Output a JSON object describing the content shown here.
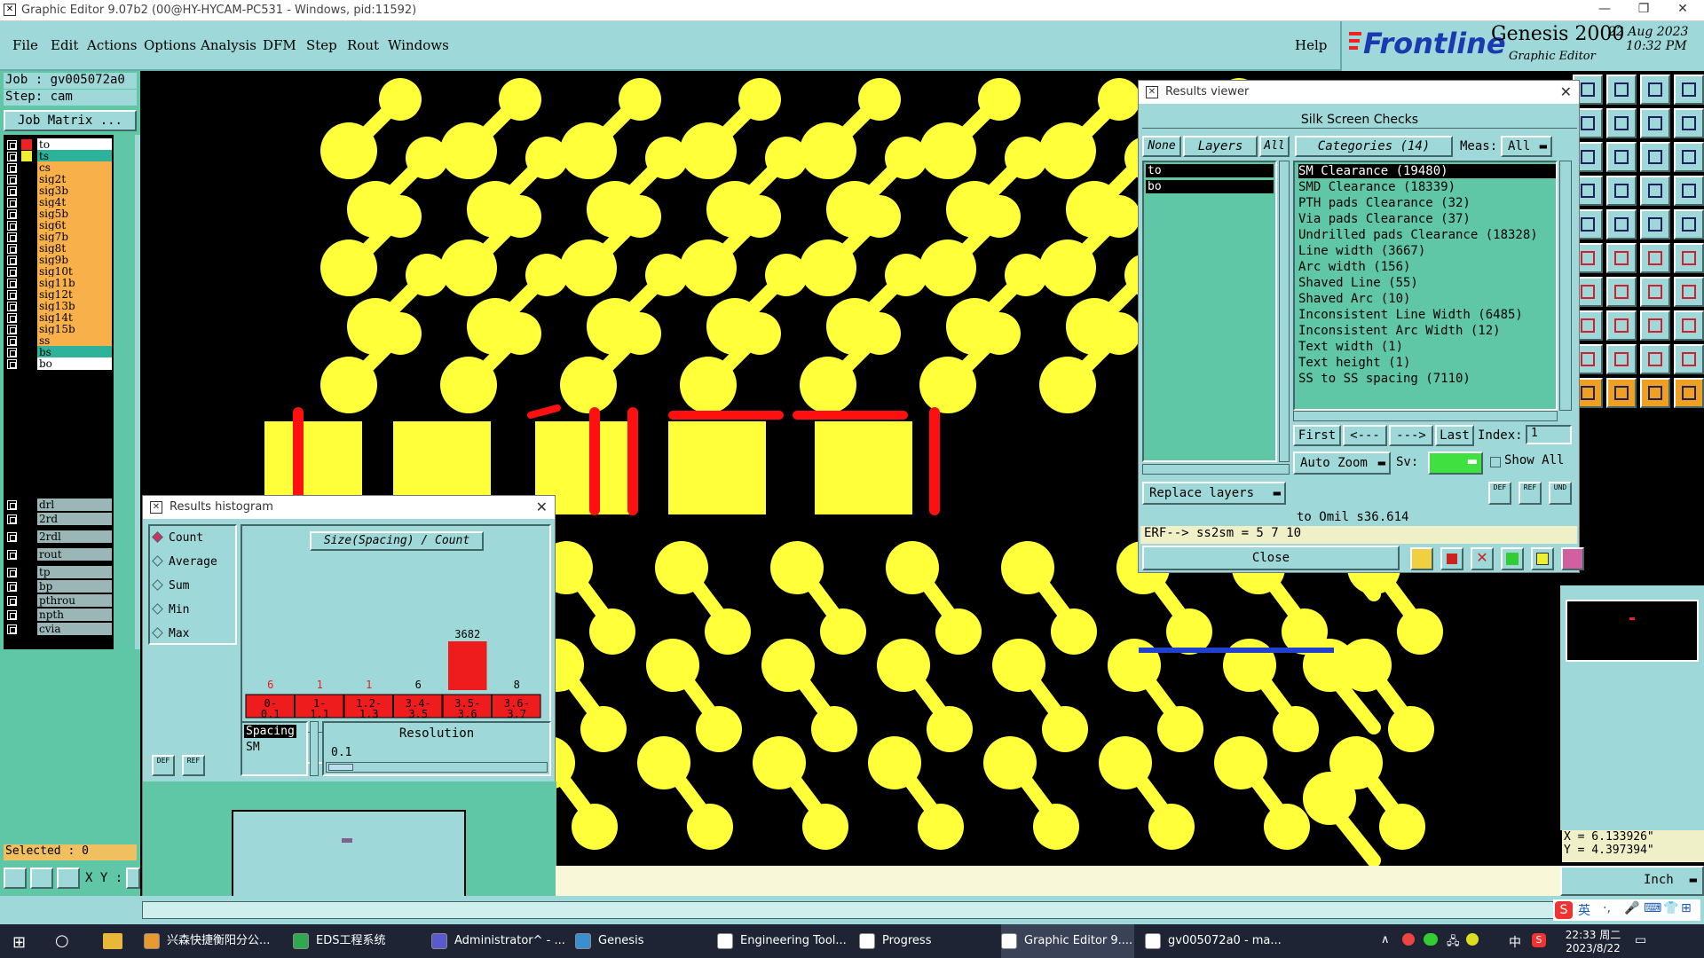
{
  "window": {
    "title": "Graphic Editor 9.07b2 (00@HY-HYCAM-PC531 - Windows, pid:11592)"
  },
  "menu": [
    "File",
    "Edit",
    "Actions",
    "Options",
    "Analysis",
    "DFM",
    "Step",
    "Rout",
    "Windows"
  ],
  "menu_help": "Help",
  "brand": {
    "logo": "Frontline",
    "product": "Genesis 2000",
    "subtitle": "Graphic Editor",
    "date": "22 Aug 2023",
    "time": "10:32 PM"
  },
  "job": {
    "job_label": "Job : gv005072a0",
    "step_label": "Step: cam",
    "matrix_button": "Job Matrix ..."
  },
  "layers": [
    {
      "name": "to",
      "color": "#ffffff"
    },
    {
      "name": "ts",
      "color": "#2db39a"
    },
    {
      "name": "cs",
      "color": "#f7b04a"
    },
    {
      "name": "sig2t",
      "color": "#f7b04a"
    },
    {
      "name": "sig3b",
      "color": "#f7b04a"
    },
    {
      "name": "sig4t",
      "color": "#f7b04a"
    },
    {
      "name": "sig5b",
      "color": "#f7b04a"
    },
    {
      "name": "sig6t",
      "color": "#f7b04a"
    },
    {
      "name": "sig7b",
      "color": "#f7b04a"
    },
    {
      "name": "sig8t",
      "color": "#f7b04a"
    },
    {
      "name": "sig9b",
      "color": "#f7b04a"
    },
    {
      "name": "sig10t",
      "color": "#f7b04a"
    },
    {
      "name": "sig11b",
      "color": "#f7b04a"
    },
    {
      "name": "sig12t",
      "color": "#f7b04a"
    },
    {
      "name": "sig13b",
      "color": "#f7b04a"
    },
    {
      "name": "sig14t",
      "color": "#f7b04a"
    },
    {
      "name": "sig15b",
      "color": "#f7b04a"
    },
    {
      "name": "ss",
      "color": "#f7b04a"
    },
    {
      "name": "bs",
      "color": "#2db39a"
    },
    {
      "name": "bo",
      "color": "#ffffff"
    }
  ],
  "layers2": [
    {
      "name": "drl",
      "color": "#9ab6b6"
    },
    {
      "name": "2rd",
      "color": "#9ab6b6"
    },
    {
      "name": "2rdl",
      "color": "#9ab6b6"
    },
    {
      "name": "rout",
      "color": "#9ab6b6"
    },
    {
      "name": "tp",
      "color": "#9ab6b6"
    },
    {
      "name": "bp",
      "color": "#9ab6b6"
    },
    {
      "name": "pthrou",
      "color": "#9ab6b6"
    },
    {
      "name": "npth",
      "color": "#9ab6b6"
    },
    {
      "name": "cvia",
      "color": "#9ab6b6"
    }
  ],
  "selected": "Selected : 0",
  "xy_label": "X Y :",
  "coords": {
    "x": "X = 6.133926\"",
    "y": "Y = 4.397394\""
  },
  "units": "Inch",
  "results_viewer": {
    "title": "Results viewer",
    "header": "Silk Screen Checks",
    "none_btn": "None",
    "layers_btn": "Layers",
    "all_btn": "All",
    "layers": [
      "to",
      "bo"
    ],
    "categories_label": "Categories (14)",
    "meas_label": "Meas:",
    "meas_value": "All",
    "categories": [
      "SM Clearance (19480)",
      "SMD Clearance (18339)",
      "PTH pads Clearance (32)",
      "Via pads Clearance (37)",
      "Undrilled pads Clearance (18328)",
      "Line width (3667)",
      "Arc width (156)",
      "Shaved Line (55)",
      "Shaved Arc (10)",
      "Inconsistent Line Width (6485)",
      "Inconsistent Arc Width (12)",
      "Text width (1)",
      "Text height (1)",
      "SS to SS spacing (7110)"
    ],
    "first": "First",
    "prev": "<---",
    "next": "--->",
    "last": "Last",
    "index_label": "Index:",
    "index_value": "1",
    "auto_zoom": "Auto Zoom",
    "sv_label": "Sv:",
    "show_all": "Show All",
    "replace_layers": "Replace layers",
    "def": "DEF",
    "ref": "REF",
    "und": "UND",
    "status": "to Omil  s36.614",
    "erf": "ERF--> ss2sm = 5 7 10",
    "close": "Close"
  },
  "histogram": {
    "title": "Results histogram",
    "options": [
      "Count",
      "Average",
      "Sum",
      "Min",
      "Max"
    ],
    "selected": "Count",
    "chart_title": "Size(Spacing) / Count",
    "spacing_label": "Spacing",
    "sm_label": "SM",
    "resolution_label": "Resolution",
    "resolution_value": "0.1",
    "def": "DEF",
    "ref": "REF"
  },
  "chart_data": {
    "type": "bar",
    "title": "Size(Spacing) / Count",
    "categories": [
      "0-0.1",
      "1-1.1",
      "1.2-1.3",
      "3.4-3.5",
      "3.5-3.6",
      "3.6-3.7"
    ],
    "values": [
      6,
      1,
      1,
      6,
      3682,
      8
    ],
    "color": "#ee1c1c"
  },
  "taskbar": [
    {
      "label": "兴森快捷衡阳分公...",
      "color": "#e89a30"
    },
    {
      "label": "EDS工程系统",
      "color": "#2fa84f"
    },
    {
      "label": "Administrator^ - ...",
      "color": "#5a5ad0"
    },
    {
      "label": "Genesis",
      "color": "#3a8fd0"
    },
    {
      "label": "Engineering Tool...",
      "color": "#ffffff"
    },
    {
      "label": "Progress",
      "color": "#ffffff"
    },
    {
      "label": "Graphic Editor 9....",
      "color": "#ffffff"
    },
    {
      "label": "gv005072a0 - ma...",
      "color": "#ffffff"
    }
  ],
  "tray": {
    "ime": "中",
    "time": "22:33 周二",
    "date": "2023/8/22"
  }
}
